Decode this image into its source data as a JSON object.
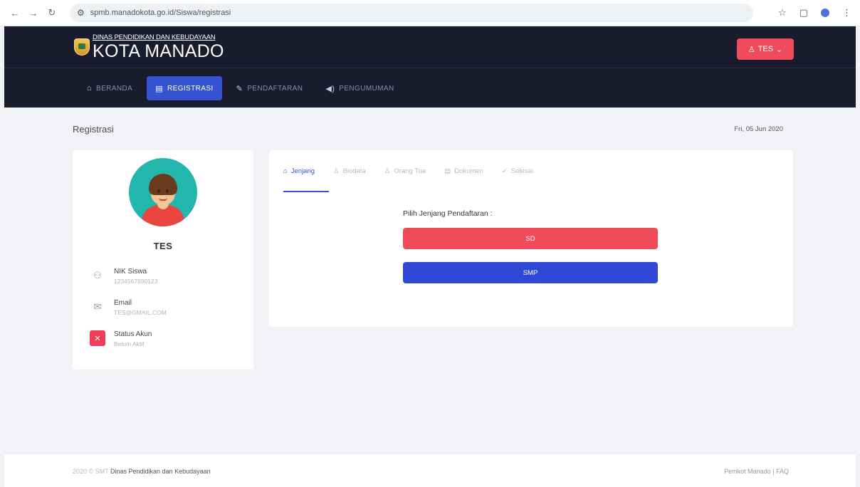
{
  "browser": {
    "url": "spmb.manadokota.go.id/Siswa/registrasi",
    "back_icon": "arrow-left",
    "forward_icon": "arrow-right",
    "reload_icon": "reload"
  },
  "header": {
    "brand_sub": "DINAS PENDIDIKAN DAN KEBUDAYAAN",
    "brand_main": "KOTA MANADO",
    "user_button": "TES",
    "nav": [
      {
        "label": "BERANDA",
        "icon": "home"
      },
      {
        "label": "REGISTRASI",
        "icon": "clipboard"
      },
      {
        "label": "PENDAFTARAN",
        "icon": "edit"
      },
      {
        "label": "PENGUMUMAN",
        "icon": "megaphone"
      }
    ]
  },
  "page": {
    "title": "Registrasi",
    "date": "Fri, 05 Jun 2020"
  },
  "profile": {
    "name": "TES",
    "fields": [
      {
        "label": "NIK Siswa",
        "value": "1234567890123"
      },
      {
        "label": "Email",
        "value": "TES@GMAIL.COM"
      },
      {
        "label": "Status Akun",
        "value": "Belum Aktif"
      }
    ]
  },
  "registration": {
    "tabs": [
      "Jenjang",
      "Biodata",
      "Orang Tua",
      "Dokumen",
      "Selesai"
    ],
    "prompt": "Pilih Jenjang Pendaftaran :",
    "levels": [
      "SD",
      "SMP"
    ]
  },
  "footer": {
    "copyright": "2020 © SMT",
    "org": "Dinas Pendidikan dan Kebudayaan",
    "right": "Pemkot Manado  |  FAQ"
  },
  "colors": {
    "header_bg": "#1a1b2d",
    "accent_blue": "#3454d1",
    "accent_red": "#ef4b5a",
    "avatar_bg": "#23b6ad"
  }
}
